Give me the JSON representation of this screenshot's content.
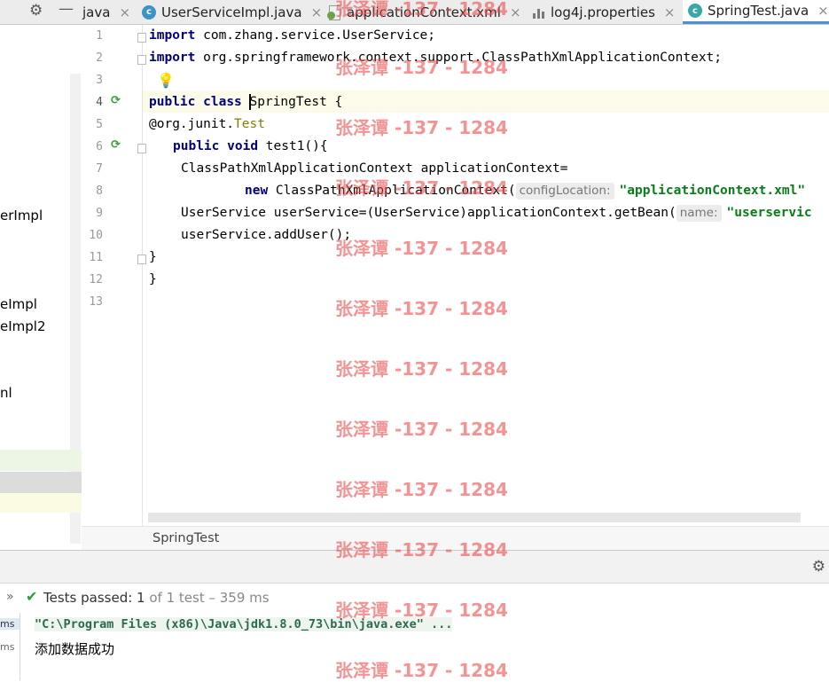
{
  "tabs": [
    {
      "label": "java",
      "icon": "none",
      "active": false
    },
    {
      "label": "UserServiceImpl.java",
      "icon": "java-class-icon",
      "active": false
    },
    {
      "label": "applicationContext.xml",
      "icon": "xml-file-icon",
      "active": false
    },
    {
      "label": "log4j.properties",
      "icon": "properties-file-icon",
      "active": false
    },
    {
      "label": "SpringTest.java",
      "icon": "java-class-icon",
      "active": true
    }
  ],
  "tab_close_glyph": "×",
  "project_items": [
    {
      "label": "erImpl"
    },
    {
      "label": "eImpl"
    },
    {
      "label": "eImpl2"
    },
    {
      "label": "nl"
    }
  ],
  "line_numbers": [
    "1",
    "2",
    "3",
    "4",
    "5",
    "6",
    "7",
    "8",
    "9",
    "10",
    "11",
    "12",
    "13"
  ],
  "code": {
    "l1_kw": "import",
    "l1_rest": " com.zhang.service.UserService;",
    "l2_kw": "import",
    "l2_rest": " org.springframework.context.support.ClassPathXmlApplicationContext;",
    "l4_kw1": "public",
    "l4_kw2": "class",
    "l4_name": "SpringTest",
    "l4_rest": " {",
    "l5_at": "@org.junit.",
    "l5_ann": "Test",
    "l6_kw1": "public",
    "l6_kw2": "void",
    "l6_rest": " test1(){",
    "l7": "ClassPathXmlApplicationContext applicationContext=",
    "l8_kw": "new",
    "l8_rest": " ClassPathXmlApplicationContext(",
    "l8_hint": "configLocation:",
    "l8_str": "\"applicationContext.xml\"",
    "l9_rest": "UserService userService=(UserService)applicationContext.getBean(",
    "l9_hint": "name:",
    "l9_str": "\"userservic",
    "l10": "userService.addUser();",
    "l11": "}",
    "l12": "}"
  },
  "breadcrumb": "SpringTest",
  "run": {
    "status_prefix": "Tests passed: ",
    "passed": "1",
    "status_detail": " of 1 test – 359 ms",
    "ms_labels": [
      "ms",
      "ms"
    ],
    "command": "\"C:\\Program Files (x86)\\Java\\jdk1.8.0_73\\bin\\java.exe\" ...",
    "output": "添加数据成功"
  },
  "watermark": "张泽谭 -137 - 1284",
  "colors": {
    "keyword": "#000080",
    "string": "#067d17",
    "annotation": "#808000",
    "pass": "#2f9a3a",
    "active_tab_underline": "#4d8fd9",
    "watermark": "#eb5050"
  }
}
